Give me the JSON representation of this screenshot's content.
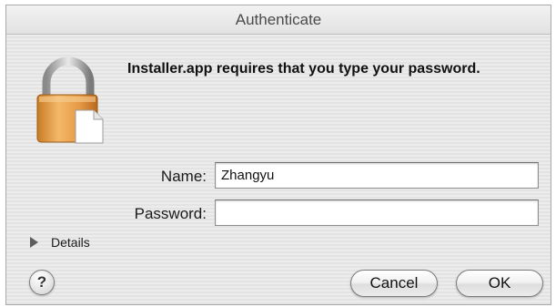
{
  "window": {
    "title": "Authenticate"
  },
  "icons": {
    "lock": "lock-icon",
    "document": "document-icon",
    "disclosure": "disclosure-triangle-icon"
  },
  "message": "Installer.app requires that you type your password.",
  "form": {
    "name_label": "Name:",
    "name_value": "Zhangyu",
    "password_label": "Password:",
    "password_value": ""
  },
  "details": {
    "label": "Details",
    "expanded": false
  },
  "buttons": {
    "help": "?",
    "cancel": "Cancel",
    "ok": "OK"
  }
}
